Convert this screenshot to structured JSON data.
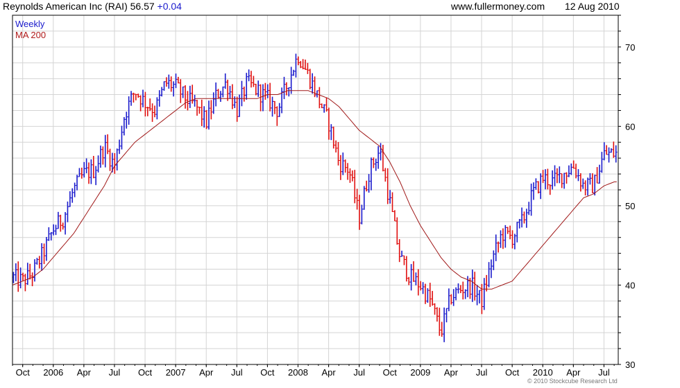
{
  "header": {
    "title": "Reynolds American Inc (RAI) 56.57",
    "change": "+0.04",
    "site": "www.fullermoney.com",
    "date": "12 Aug 2010"
  },
  "legend": {
    "weekly": "Weekly",
    "ma": "MA 200"
  },
  "copyright": "© 2010 Stockcube Research Ltd",
  "colors": {
    "up": "#1a1acc",
    "down": "#e01010",
    "ma": "#a01818",
    "grid": "#d4d4d4",
    "axis": "#000000"
  },
  "chart_data": {
    "type": "line",
    "title": "Reynolds American Inc (RAI) 56.57 +0.04",
    "interval": "Weekly",
    "xlabel": "",
    "ylabel": "",
    "ylim": [
      30,
      74
    ],
    "y_ticks": [
      30,
      40,
      50,
      60,
      70
    ],
    "x_ticks": [
      "Oct",
      "2006",
      "Apr",
      "Jul",
      "Oct",
      "2007",
      "Apr",
      "Jul",
      "Oct",
      "2008",
      "Apr",
      "Jul",
      "Oct",
      "2009",
      "Apr",
      "Jul",
      "Oct",
      "2010",
      "Apr",
      "Jul"
    ],
    "grid": true,
    "legend_position": "top-left",
    "series": [
      {
        "name": "Weekly",
        "style": "price bars",
        "points": [
          [
            "Sep 2005",
            41.0
          ],
          [
            "Oct 2005",
            40.5
          ],
          [
            "Nov 2005",
            41.5
          ],
          [
            "Dec 2005",
            44.0
          ],
          [
            "Jan 2006",
            47.0
          ],
          [
            "Feb 2006",
            48.5
          ],
          [
            "Mar 2006",
            52.0
          ],
          [
            "Apr 2006",
            54.0
          ],
          [
            "May 2006",
            54.5
          ],
          [
            "Jun 2006",
            57.5
          ],
          [
            "Jul 2006",
            55.0
          ],
          [
            "Aug 2006",
            61.5
          ],
          [
            "Sep 2006",
            64.5
          ],
          [
            "Oct 2006",
            63.0
          ],
          [
            "Nov 2006",
            62.0
          ],
          [
            "Dec 2006",
            65.5
          ],
          [
            "Jan 2007",
            65.0
          ],
          [
            "Feb 2007",
            63.5
          ],
          [
            "Mar 2007",
            62.5
          ],
          [
            "Apr 2007",
            60.5
          ],
          [
            "May 2007",
            64.0
          ],
          [
            "Jun 2007",
            65.5
          ],
          [
            "Jul 2007",
            62.0
          ],
          [
            "Aug 2007",
            65.5
          ],
          [
            "Sep 2007",
            64.5
          ],
          [
            "Oct 2007",
            63.5
          ],
          [
            "Nov 2007",
            62.0
          ],
          [
            "Dec 2007",
            65.5
          ],
          [
            "Jan 2008",
            69.0
          ],
          [
            "Feb 2008",
            66.5
          ],
          [
            "Mar 2008",
            63.5
          ],
          [
            "Apr 2008",
            60.5
          ],
          [
            "May 2008",
            55.5
          ],
          [
            "Jun 2008",
            54.5
          ],
          [
            "Jul 2008",
            48.5
          ],
          [
            "Aug 2008",
            54.5
          ],
          [
            "Sep 2008",
            57.0
          ],
          [
            "Oct 2008",
            50.5
          ],
          [
            "Nov 2008",
            43.5
          ],
          [
            "Dec 2008",
            41.0
          ],
          [
            "Jan 2009",
            40.0
          ],
          [
            "Feb 2009",
            38.0
          ],
          [
            "Mar 2009",
            34.0
          ],
          [
            "Apr 2009",
            38.5
          ],
          [
            "May 2009",
            39.5
          ],
          [
            "Jun 2009",
            40.0
          ],
          [
            "Jul 2009",
            38.0
          ],
          [
            "Aug 2009",
            43.0
          ],
          [
            "Sep 2009",
            46.5
          ],
          [
            "Oct 2009",
            46.0
          ],
          [
            "Nov 2009",
            48.0
          ],
          [
            "Dec 2009",
            51.5
          ],
          [
            "Jan 2010",
            53.5
          ],
          [
            "Feb 2010",
            53.0
          ],
          [
            "Mar 2010",
            54.0
          ],
          [
            "Apr 2010",
            55.0
          ],
          [
            "May 2010",
            52.5
          ],
          [
            "Jun 2010",
            52.5
          ],
          [
            "Jul 2010",
            56.5
          ],
          [
            "Aug 2010",
            56.6
          ]
        ]
      },
      {
        "name": "MA 200",
        "style": "line",
        "points": [
          [
            "Sep 2005",
            40.0
          ],
          [
            "Oct 2005",
            40.5
          ],
          [
            "Nov 2005",
            41.0
          ],
          [
            "Dec 2005",
            42.0
          ],
          [
            "Jan 2006",
            43.5
          ],
          [
            "Feb 2006",
            45.0
          ],
          [
            "Mar 2006",
            46.5
          ],
          [
            "Apr 2006",
            48.5
          ],
          [
            "May 2006",
            50.5
          ],
          [
            "Jun 2006",
            52.5
          ],
          [
            "Jul 2006",
            55.0
          ],
          [
            "Aug 2006",
            56.5
          ],
          [
            "Sep 2006",
            58.0
          ],
          [
            "Oct 2006",
            59.0
          ],
          [
            "Nov 2006",
            60.0
          ],
          [
            "Dec 2006",
            61.0
          ],
          [
            "Jan 2007",
            62.0
          ],
          [
            "Feb 2007",
            63.0
          ],
          [
            "Mar 2007",
            63.5
          ],
          [
            "Apr 2007",
            63.5
          ],
          [
            "May 2007",
            63.5
          ],
          [
            "Jun 2007",
            63.5
          ],
          [
            "Jul 2007",
            63.5
          ],
          [
            "Aug 2007",
            63.5
          ],
          [
            "Sep 2007",
            63.5
          ],
          [
            "Oct 2007",
            64.0
          ],
          [
            "Nov 2007",
            64.0
          ],
          [
            "Dec 2007",
            64.5
          ],
          [
            "Jan 2008",
            64.5
          ],
          [
            "Feb 2008",
            64.5
          ],
          [
            "Mar 2008",
            64.0
          ],
          [
            "Apr 2008",
            63.5
          ],
          [
            "May 2008",
            62.5
          ],
          [
            "Jun 2008",
            61.0
          ],
          [
            "Jul 2008",
            59.5
          ],
          [
            "Aug 2008",
            58.5
          ],
          [
            "Sep 2008",
            57.5
          ],
          [
            "Oct 2008",
            55.5
          ],
          [
            "Nov 2008",
            53.0
          ],
          [
            "Dec 2008",
            50.0
          ],
          [
            "Jan 2009",
            47.5
          ],
          [
            "Feb 2009",
            45.5
          ],
          [
            "Mar 2009",
            43.5
          ],
          [
            "Apr 2009",
            42.0
          ],
          [
            "May 2009",
            41.0
          ],
          [
            "Jun 2009",
            40.5
          ],
          [
            "Jul 2009",
            39.5
          ],
          [
            "Aug 2009",
            39.5
          ],
          [
            "Sep 2009",
            40.0
          ],
          [
            "Oct 2009",
            40.5
          ],
          [
            "Nov 2009",
            42.0
          ],
          [
            "Dec 2009",
            43.5
          ],
          [
            "Jan 2010",
            45.0
          ],
          [
            "Feb 2010",
            46.5
          ],
          [
            "Mar 2010",
            48.0
          ],
          [
            "Apr 2010",
            49.5
          ],
          [
            "May 2010",
            51.0
          ],
          [
            "Jun 2010",
            51.5
          ],
          [
            "Jul 2010",
            52.5
          ],
          [
            "Aug 2010",
            53.0
          ]
        ]
      }
    ]
  }
}
